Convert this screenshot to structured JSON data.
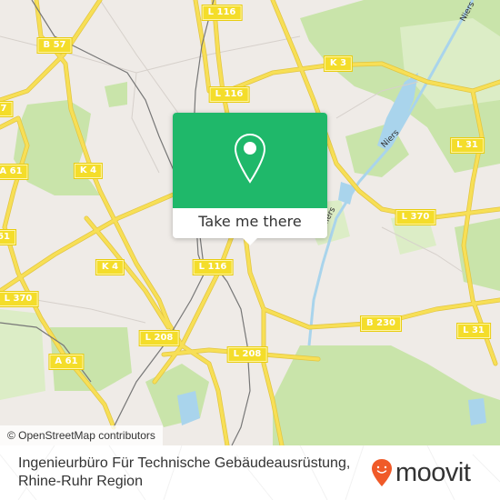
{
  "map": {
    "attribution": "© OpenStreetMap contributors",
    "colors": {
      "background": "#efebe7",
      "park": "#c9e4aa",
      "park_light": "#dcedc6",
      "water": "#a9d4ec",
      "road": "#f7df56",
      "road_casing": "#e2c540",
      "rail": "#777777",
      "label_bg": "#f4dd2a",
      "popup_accent": "#1fb86a",
      "brand": "#f05a28"
    },
    "road_labels": [
      {
        "id": "l116-top",
        "text": "L 116"
      },
      {
        "id": "b57",
        "text": "B 57"
      },
      {
        "id": "k3",
        "text": "K 3"
      },
      {
        "id": "l116-mid",
        "text": "L 116"
      },
      {
        "id": "a61-left-upper-partial",
        "text": "7"
      },
      {
        "id": "l31-upper",
        "text": "L 31"
      },
      {
        "id": "a61-left",
        "text": "A 61"
      },
      {
        "id": "k4-upper",
        "text": "K 4"
      },
      {
        "id": "l370-right",
        "text": "L 370"
      },
      {
        "id": "a61-partial",
        "text": "61"
      },
      {
        "id": "k4-lower",
        "text": "K 4"
      },
      {
        "id": "l116-lower",
        "text": "L 116"
      },
      {
        "id": "l370-left",
        "text": "L 370"
      },
      {
        "id": "b230",
        "text": "B 230"
      },
      {
        "id": "l31-lower",
        "text": "L 31"
      },
      {
        "id": "l208-left",
        "text": "L 208"
      },
      {
        "id": "l208-right",
        "text": "L 208"
      },
      {
        "id": "a61-lower",
        "text": "A 61"
      }
    ],
    "river_labels": [
      {
        "id": "niers-upper",
        "text": "Niers"
      },
      {
        "id": "niers-lower",
        "text": "Niers"
      },
      {
        "id": "niers-center",
        "text": "Niers"
      }
    ]
  },
  "popup": {
    "icon": "map-pin-icon",
    "button_label": "Take me there"
  },
  "footer": {
    "place_line1": "Ingenieurbüro Für Technische Gebäudeausrüstung,",
    "place_line2": "Rhine-Ruhr Region",
    "brand": "moovit",
    "brand_icon": "moovit-pin-smile-icon"
  }
}
